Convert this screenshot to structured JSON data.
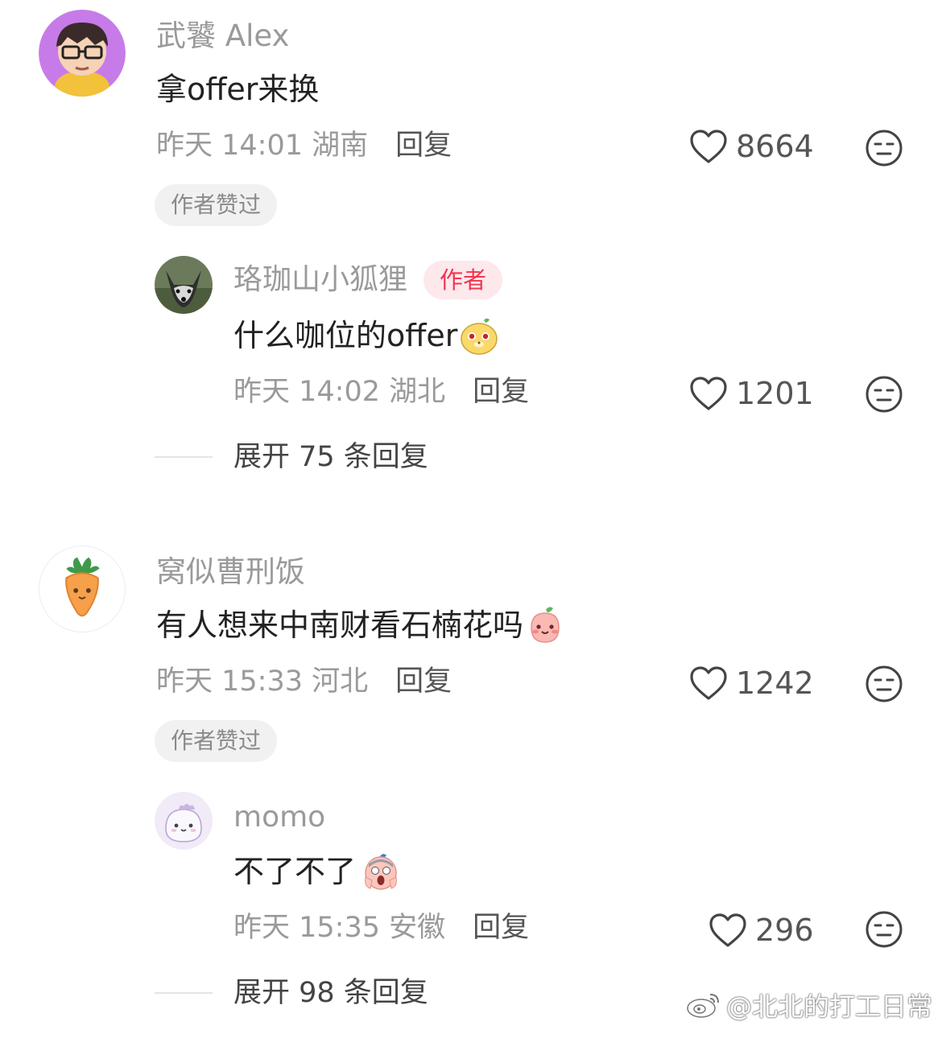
{
  "comments": [
    {
      "user": "武饕 Alex",
      "text": "拿offer来换",
      "time": "昨天 14:01 湖南",
      "reply_label": "回复",
      "likes": "8664",
      "liked_by_author": "作者赞过",
      "replies": [
        {
          "user": "珞珈山小狐狸",
          "author_badge": "作者",
          "text": "什么咖位的offer",
          "time": "昨天 14:02 湖北",
          "reply_label": "回复",
          "likes": "1201"
        }
      ],
      "expand_label": "展开 75 条回复"
    },
    {
      "user": "窝似曹刑饭",
      "text": "有人想来中南财看石楠花吗",
      "time": "昨天 15:33 河北",
      "reply_label": "回复",
      "likes": "1242",
      "liked_by_author": "作者赞过",
      "replies": [
        {
          "user": "momo",
          "text": "不了不了",
          "time": "昨天 15:35 安徽",
          "reply_label": "回复",
          "likes": "296"
        }
      ],
      "expand_label": "展开 98 条回复"
    }
  ],
  "watermark": "@北北的打工日常",
  "colors": {
    "author_badge_bg": "#fde8ec",
    "author_badge_text": "#f0364f",
    "muted": "#9a9a9a"
  },
  "icons": [
    "heart-icon",
    "neutral-face-icon",
    "weibo-logo-icon"
  ]
}
